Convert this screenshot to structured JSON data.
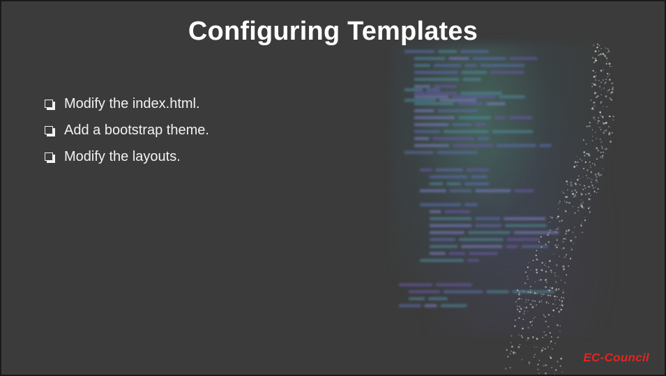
{
  "slide": {
    "title": "Configuring Templates",
    "bullets": [
      {
        "text": "Modify the index.html.",
        "icon": "checkbox-icon"
      },
      {
        "text": "Add a bootstrap theme.",
        "icon": "checkbox-icon"
      },
      {
        "text": "Modify the layouts.",
        "icon": "checkbox-icon"
      }
    ],
    "logo_text": "EC-Council"
  },
  "colors": {
    "background": "#3b3b3b",
    "title": "#ffffff",
    "bullet_text": "#f2f2f2",
    "logo": "#e52420"
  }
}
